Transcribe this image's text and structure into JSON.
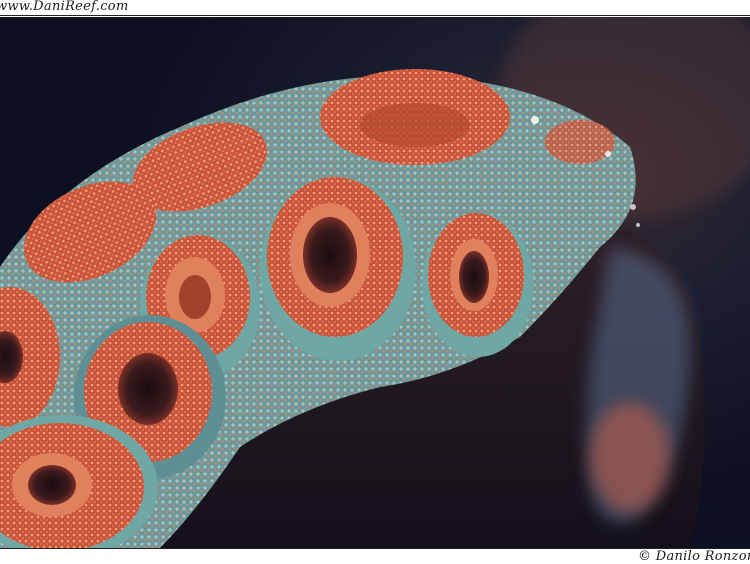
{
  "watermarks": {
    "top": "www.DaniReef.com",
    "bottom": "© Danilo Ronzoni"
  },
  "photo": {
    "subject": "coral-colony-macro",
    "colors": {
      "background": "#141a2c",
      "rock": "#2a1d24",
      "polyp_orange": "#d4593a",
      "polyp_rim": "#e8825e",
      "tentacle_teal": "#8fc9c4",
      "mouth_dark": "#2a1418"
    }
  }
}
